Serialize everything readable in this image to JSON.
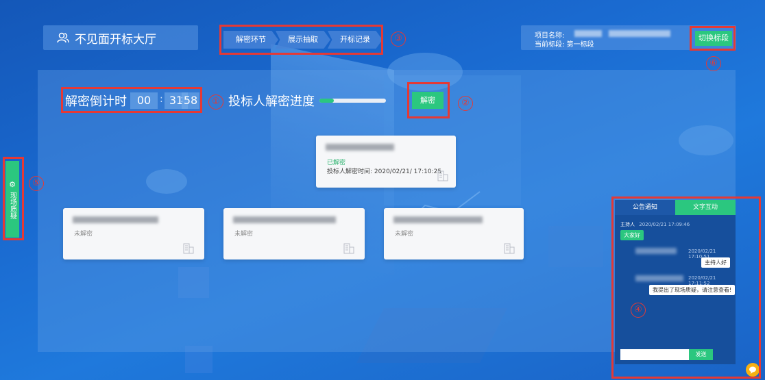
{
  "header": {
    "title": "不见面开标大厅",
    "icon": "users-icon",
    "tabs": [
      {
        "label": "解密环节"
      },
      {
        "label": "展示抽取"
      },
      {
        "label": "开标记录"
      }
    ],
    "project": {
      "name_label": "项目名称:",
      "section_label": "当前标段: 第一标段"
    },
    "switch_label": "切换标段"
  },
  "countdown": {
    "label": "解密倒计时",
    "hours": "00",
    "minutes": "31",
    "seconds": "58",
    "separator": ":"
  },
  "progress": {
    "label": "投标人解密进度",
    "fraction": 0.22
  },
  "decrypt_label": "解密",
  "bidders": [
    {
      "status": "已解密",
      "time_label": "投标人解密时间: 2020/02/21/ 17:10:25",
      "icon": "building-icon"
    },
    {
      "status": "未解密",
      "icon": "building-icon"
    },
    {
      "status": "未解密",
      "icon": "building-icon"
    },
    {
      "status": "未解密",
      "icon": "building-icon"
    }
  ],
  "side_tab": {
    "label": "现场质疑",
    "icon": "gear-icon"
  },
  "chat": {
    "tabs": [
      {
        "label": "公告通知"
      },
      {
        "label": "文字互动"
      }
    ],
    "messages": [
      {
        "sender": "主持人",
        "time": "2020/02/21 17:09:46",
        "text": "大家好"
      },
      {
        "time": "2020/02/21 17:10:51",
        "text": "主持人好"
      },
      {
        "time": "2020/02/21 17:11:52",
        "text": "我提出了现场质疑，请注意查看!"
      }
    ],
    "send_label": "发送"
  },
  "annotations": [
    "①",
    "②",
    "③",
    "④",
    "⑤",
    "⑥"
  ],
  "colors": {
    "accent": "#2bc77f",
    "annotation": "#e53935",
    "help": "#f5b014"
  }
}
